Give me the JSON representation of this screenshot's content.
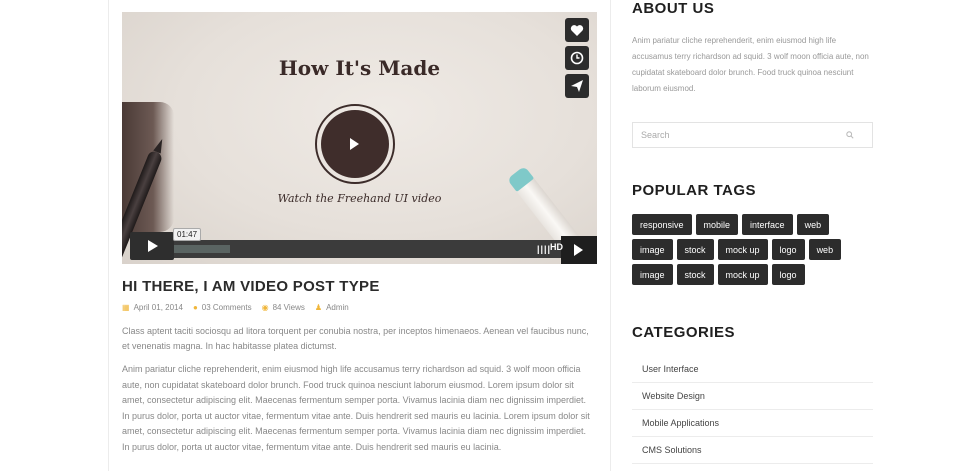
{
  "video": {
    "title": "How It's Made",
    "subtitle": "Watch the Freehand UI video",
    "current_time": "01:47",
    "progress": 0.16,
    "quality_label": "HD",
    "side_actions": [
      "heart-icon",
      "clock-icon",
      "send-icon"
    ]
  },
  "post": {
    "title": "HI THERE, I AM VIDEO POST TYPE",
    "date": "April 01, 2014",
    "comments": "03 Comments",
    "views": "84 Views",
    "author": "Admin",
    "excerpt": "Class aptent taciti sociosqu ad litora torquent per conubia nostra, per inceptos himenaeos. Aenean vel faucibus nunc, et venenatis magna. In hac habitasse platea dictumst.",
    "body": "Anim pariatur cliche reprehenderit, enim eiusmod high life accusamus terry richardson ad squid. 3 wolf moon officia aute, non cupidatat skateboard dolor brunch. Food truck quinoa nesciunt laborum eiusmod. Lorem ipsum dolor sit amet, consectetur adipiscing elit. Maecenas fermentum semper porta. Vivamus lacinia diam nec dignissim imperdiet. In purus dolor, porta ut auctor vitae, fermentum vitae ante. Duis hendrerit sed mauris eu lacinia. Lorem ipsum dolor sit amet, consectetur adipiscing elit. Maecenas fermentum semper porta. Vivamus lacinia diam nec dignissim imperdiet. In purus dolor, porta ut auctor vitae, fermentum vitae ante. Duis hendrerit sed mauris eu lacinia."
  },
  "sidebar": {
    "about_title": "ABOUT US",
    "about_text": "Anim pariatur cliche reprehenderit, enim eiusmod high life accusamus terry richardson ad squid. 3 wolf moon officia aute, non cupidatat skateboard dolor brunch. Food truck quinoa nesciunt laborum eiusmod.",
    "search_placeholder": "Search",
    "tags_title": "POPULAR TAGS",
    "tag_rows": [
      [
        "responsive",
        "mobile",
        "interface",
        "web"
      ],
      [
        "image",
        "stock",
        "mock up",
        "logo",
        "web"
      ],
      [
        "image",
        "stock",
        "mock up",
        "logo"
      ]
    ],
    "categories_title": "CATEGORIES",
    "categories": [
      "User Interface",
      "Website Design",
      "Mobile Applications",
      "CMS Solutions"
    ]
  },
  "colors": {
    "accent": "#f0b63a",
    "dark": "#2c2c2c"
  }
}
